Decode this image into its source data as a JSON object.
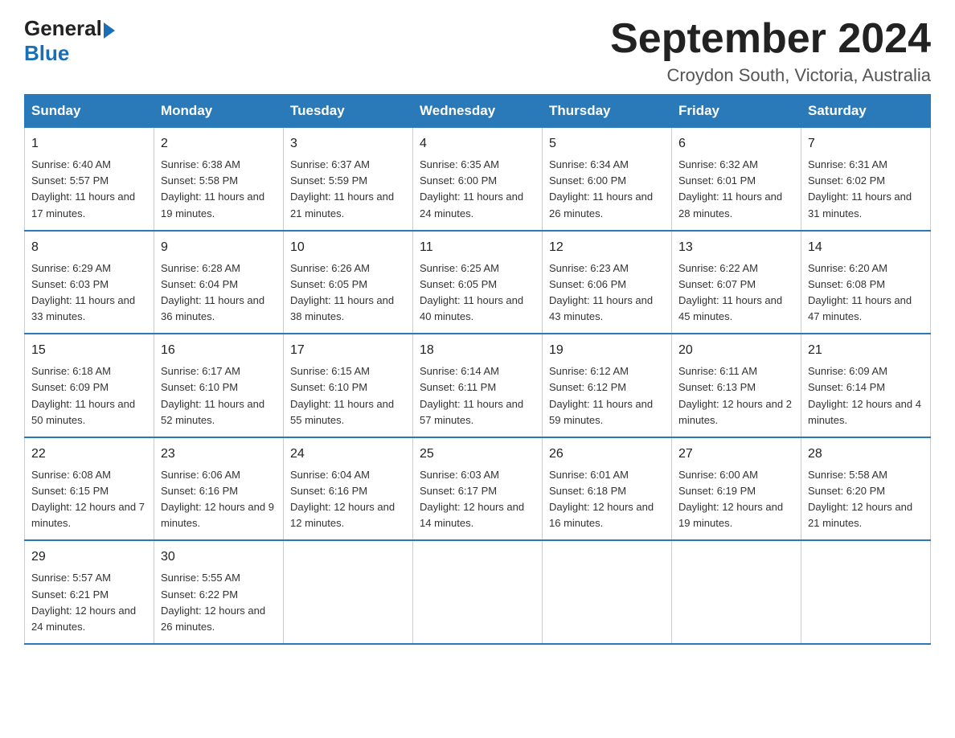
{
  "logo": {
    "text_general": "General",
    "text_blue": "Blue"
  },
  "header": {
    "month": "September 2024",
    "location": "Croydon South, Victoria, Australia"
  },
  "weekdays": [
    "Sunday",
    "Monday",
    "Tuesday",
    "Wednesday",
    "Thursday",
    "Friday",
    "Saturday"
  ],
  "weeks": [
    [
      {
        "day": "1",
        "sunrise": "6:40 AM",
        "sunset": "5:57 PM",
        "daylight": "11 hours and 17 minutes."
      },
      {
        "day": "2",
        "sunrise": "6:38 AM",
        "sunset": "5:58 PM",
        "daylight": "11 hours and 19 minutes."
      },
      {
        "day": "3",
        "sunrise": "6:37 AM",
        "sunset": "5:59 PM",
        "daylight": "11 hours and 21 minutes."
      },
      {
        "day": "4",
        "sunrise": "6:35 AM",
        "sunset": "6:00 PM",
        "daylight": "11 hours and 24 minutes."
      },
      {
        "day": "5",
        "sunrise": "6:34 AM",
        "sunset": "6:00 PM",
        "daylight": "11 hours and 26 minutes."
      },
      {
        "day": "6",
        "sunrise": "6:32 AM",
        "sunset": "6:01 PM",
        "daylight": "11 hours and 28 minutes."
      },
      {
        "day": "7",
        "sunrise": "6:31 AM",
        "sunset": "6:02 PM",
        "daylight": "11 hours and 31 minutes."
      }
    ],
    [
      {
        "day": "8",
        "sunrise": "6:29 AM",
        "sunset": "6:03 PM",
        "daylight": "11 hours and 33 minutes."
      },
      {
        "day": "9",
        "sunrise": "6:28 AM",
        "sunset": "6:04 PM",
        "daylight": "11 hours and 36 minutes."
      },
      {
        "day": "10",
        "sunrise": "6:26 AM",
        "sunset": "6:05 PM",
        "daylight": "11 hours and 38 minutes."
      },
      {
        "day": "11",
        "sunrise": "6:25 AM",
        "sunset": "6:05 PM",
        "daylight": "11 hours and 40 minutes."
      },
      {
        "day": "12",
        "sunrise": "6:23 AM",
        "sunset": "6:06 PM",
        "daylight": "11 hours and 43 minutes."
      },
      {
        "day": "13",
        "sunrise": "6:22 AM",
        "sunset": "6:07 PM",
        "daylight": "11 hours and 45 minutes."
      },
      {
        "day": "14",
        "sunrise": "6:20 AM",
        "sunset": "6:08 PM",
        "daylight": "11 hours and 47 minutes."
      }
    ],
    [
      {
        "day": "15",
        "sunrise": "6:18 AM",
        "sunset": "6:09 PM",
        "daylight": "11 hours and 50 minutes."
      },
      {
        "day": "16",
        "sunrise": "6:17 AM",
        "sunset": "6:10 PM",
        "daylight": "11 hours and 52 minutes."
      },
      {
        "day": "17",
        "sunrise": "6:15 AM",
        "sunset": "6:10 PM",
        "daylight": "11 hours and 55 minutes."
      },
      {
        "day": "18",
        "sunrise": "6:14 AM",
        "sunset": "6:11 PM",
        "daylight": "11 hours and 57 minutes."
      },
      {
        "day": "19",
        "sunrise": "6:12 AM",
        "sunset": "6:12 PM",
        "daylight": "11 hours and 59 minutes."
      },
      {
        "day": "20",
        "sunrise": "6:11 AM",
        "sunset": "6:13 PM",
        "daylight": "12 hours and 2 minutes."
      },
      {
        "day": "21",
        "sunrise": "6:09 AM",
        "sunset": "6:14 PM",
        "daylight": "12 hours and 4 minutes."
      }
    ],
    [
      {
        "day": "22",
        "sunrise": "6:08 AM",
        "sunset": "6:15 PM",
        "daylight": "12 hours and 7 minutes."
      },
      {
        "day": "23",
        "sunrise": "6:06 AM",
        "sunset": "6:16 PM",
        "daylight": "12 hours and 9 minutes."
      },
      {
        "day": "24",
        "sunrise": "6:04 AM",
        "sunset": "6:16 PM",
        "daylight": "12 hours and 12 minutes."
      },
      {
        "day": "25",
        "sunrise": "6:03 AM",
        "sunset": "6:17 PM",
        "daylight": "12 hours and 14 minutes."
      },
      {
        "day": "26",
        "sunrise": "6:01 AM",
        "sunset": "6:18 PM",
        "daylight": "12 hours and 16 minutes."
      },
      {
        "day": "27",
        "sunrise": "6:00 AM",
        "sunset": "6:19 PM",
        "daylight": "12 hours and 19 minutes."
      },
      {
        "day": "28",
        "sunrise": "5:58 AM",
        "sunset": "6:20 PM",
        "daylight": "12 hours and 21 minutes."
      }
    ],
    [
      {
        "day": "29",
        "sunrise": "5:57 AM",
        "sunset": "6:21 PM",
        "daylight": "12 hours and 24 minutes."
      },
      {
        "day": "30",
        "sunrise": "5:55 AM",
        "sunset": "6:22 PM",
        "daylight": "12 hours and 26 minutes."
      },
      null,
      null,
      null,
      null,
      null
    ]
  ]
}
